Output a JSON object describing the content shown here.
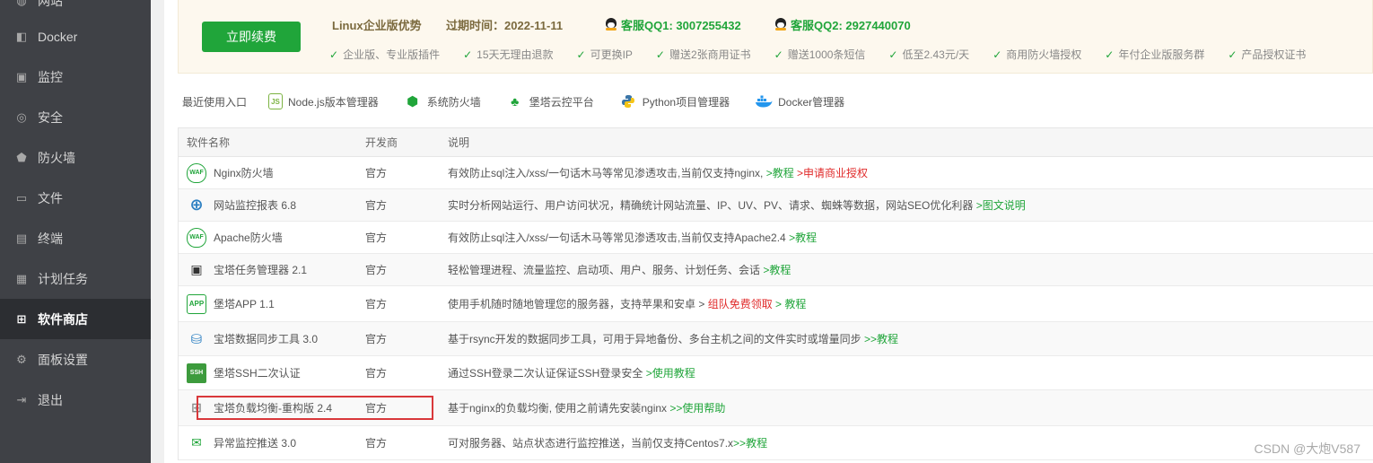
{
  "sidebar": {
    "partial_label": "网站",
    "items": [
      {
        "label": "Docker",
        "icon": "docker-icon",
        "glyph": "🐳"
      },
      {
        "label": "监控",
        "icon": "monitor-icon",
        "glyph": "▣"
      },
      {
        "label": "安全",
        "icon": "shield-check-icon",
        "glyph": "◎"
      },
      {
        "label": "防火墙",
        "icon": "shield-icon",
        "glyph": "⬟"
      },
      {
        "label": "文件",
        "icon": "folder-icon",
        "glyph": "▭"
      },
      {
        "label": "终端",
        "icon": "terminal-icon",
        "glyph": "▤"
      },
      {
        "label": "计划任务",
        "icon": "calendar-icon",
        "glyph": "▦"
      },
      {
        "label": "软件商店",
        "icon": "grid-icon",
        "glyph": "⊞"
      },
      {
        "label": "面板设置",
        "icon": "gear-icon",
        "glyph": "⚙"
      },
      {
        "label": "退出",
        "icon": "logout-icon",
        "glyph": "⇥"
      }
    ]
  },
  "banner": {
    "renew_button": "立即续费",
    "title": "Linux企业版优势",
    "expire": "过期时间：2022-11-11",
    "qq1": "客服QQ1: 3007255432",
    "qq2": "客服QQ2: 2927440070",
    "features": [
      "企业版、专业版插件",
      "15天无理由退款",
      "可更换IP",
      "赠送2张商用证书",
      "赠送1000条短信",
      "低至2.43元/天",
      "商用防火墙授权",
      "年付企业版服务群",
      "产品授权证书"
    ]
  },
  "recent": {
    "label": "最近使用入口",
    "items": [
      {
        "label": "Node.js版本管理器",
        "icon": "nodejs-icon"
      },
      {
        "label": "系统防火墙",
        "icon": "firewall-icon"
      },
      {
        "label": "堡塔云控平台",
        "icon": "cloud-control-icon"
      },
      {
        "label": "Python项目管理器",
        "icon": "python-icon"
      },
      {
        "label": "Docker管理器",
        "icon": "docker-manager-icon"
      }
    ]
  },
  "table": {
    "headers": [
      "软件名称",
      "开发商",
      "说明"
    ],
    "rows": [
      {
        "name": "Nginx防火墙",
        "icon": "waf-icon",
        "vendor": "官方",
        "desc": "有效防止sql注入/xss/一句话木马等常见渗透攻击,当前仅支持nginx,",
        "links": [
          {
            "text": " >教程",
            "color": "green"
          },
          {
            "text": " >申请商业授权",
            "color": "red"
          }
        ]
      },
      {
        "name": "网站监控报表 6.8",
        "icon": "target-icon",
        "vendor": "官方",
        "desc": "实时分析网站运行、用户访问状况，精确统计网站流量、IP、UV、PV、请求、蜘蛛等数据，网站SEO优化利器",
        "links": [
          {
            "text": " >图文说明",
            "color": "green"
          }
        ]
      },
      {
        "name": "Apache防火墙",
        "icon": "waf-icon",
        "vendor": "官方",
        "desc": "有效防止sql注入/xss/一句话木马等常见渗透攻击,当前仅支持Apache2.4",
        "links": [
          {
            "text": " >教程",
            "color": "green"
          }
        ]
      },
      {
        "name": "宝塔任务管理器 2.1",
        "icon": "task-manager-icon",
        "vendor": "官方",
        "desc": "轻松管理进程、流量监控、启动项、用户、服务、计划任务、会话",
        "links": [
          {
            "text": " >教程",
            "color": "green"
          }
        ]
      },
      {
        "name": "堡塔APP 1.1",
        "icon": "app-icon",
        "vendor": "官方",
        "desc": "使用手机随时随地管理您的服务器，支持苹果和安卓",
        "links": [
          {
            "text": " > ",
            "color": "normal"
          },
          {
            "text": "组队免费领取",
            "color": "red"
          },
          {
            "text": " > 教程",
            "color": "green"
          }
        ]
      },
      {
        "name": "宝塔数据同步工具 3.0",
        "icon": "database-sync-icon",
        "vendor": "官方",
        "desc": "基于rsync开发的数据同步工具，可用于异地备份、多台主机之间的文件实时或增量同步",
        "links": [
          {
            "text": " >>教程",
            "color": "green"
          }
        ]
      },
      {
        "name": "堡塔SSH二次认证",
        "icon": "ssh-icon",
        "vendor": "官方",
        "desc": "通过SSH登录二次认证保证SSH登录安全",
        "links": [
          {
            "text": " >使用教程",
            "color": "green"
          }
        ]
      },
      {
        "name": "宝塔负载均衡-重构版 2.4",
        "icon": "load-balance-icon",
        "vendor": "官方",
        "desc": "基于nginx的负载均衡, 使用之前请先安装nginx",
        "links": [
          {
            "text": " >>使用帮助",
            "color": "green"
          }
        ]
      },
      {
        "name": "异常监控推送 3.0",
        "icon": "alert-push-icon",
        "vendor": "官方",
        "desc": "可对服务器、站点状态进行监控推送，当前仅支持Centos7.x",
        "links": [
          {
            "text": ">>教程",
            "color": "green"
          }
        ]
      }
    ]
  },
  "watermark": "CSDN @大炮V587"
}
